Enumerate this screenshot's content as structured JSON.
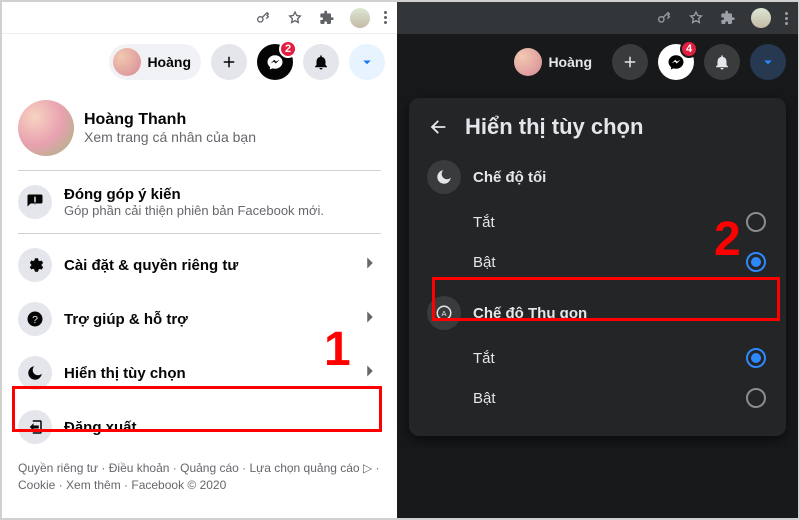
{
  "left": {
    "chrome": {
      "avatar": true
    },
    "header": {
      "user_first_name": "Hoàng",
      "messenger_badge": "2"
    },
    "profile": {
      "name": "Hoàng Thanh",
      "subtitle": "Xem trang cá nhân của bạn"
    },
    "feedback": {
      "title": "Đóng góp ý kiến",
      "subtitle": "Góp phần cải thiện phiên bản Facebook mới."
    },
    "menu": {
      "settings": "Cài đặt & quyền riêng tư",
      "help": "Trợ giúp & hỗ trợ",
      "display": "Hiển thị tùy chọn",
      "logout": "Đăng xuất"
    },
    "footer": "Quyền riêng tư · Điều khoản · Quảng cáo · Lựa chọn quảng cáo ▷ · Cookie · Xem thêm · Facebook © 2020"
  },
  "right": {
    "header": {
      "user_first_name": "Hoàng",
      "messenger_badge": "4"
    },
    "sheet_title": "Hiển thị tùy chọn",
    "dark_mode": {
      "label": "Chế độ tối",
      "off": "Tắt",
      "on": "Bật",
      "selected": "on"
    },
    "compact_mode": {
      "label": "Chế độ Thu gọn",
      "off": "Tắt",
      "on": "Bật",
      "selected": "off"
    }
  },
  "annotations": {
    "num1": "1",
    "num2": "2"
  }
}
